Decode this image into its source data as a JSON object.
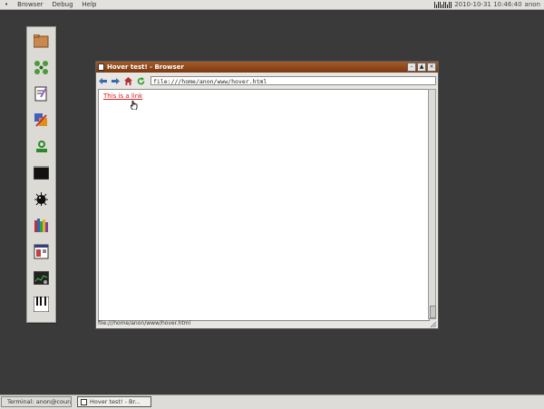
{
  "top_menu": {
    "items": [
      "Browser",
      "Debug",
      "Help"
    ],
    "clock": "2010-10-31 10:46:40",
    "user": "anon"
  },
  "dock": {
    "icons": [
      "folder-icon",
      "grid-icon",
      "notepad-icon",
      "paint-icon",
      "user-manager-icon",
      "terminal-icon",
      "bomb-icon",
      "books-icon",
      "computer-window-icon",
      "system-monitor-icon",
      "piano-icon"
    ]
  },
  "window": {
    "title": "Hover test! - Browser",
    "url": "file:///home/anon/www/hover.html",
    "link_text": "This is a link",
    "status": "file:///home/anon/www/hover.html"
  },
  "taskbar": {
    "tasks": [
      {
        "label": "Terminal: anon@courage:~",
        "active": false
      },
      {
        "label": "Hover test! - Br...",
        "active": true
      }
    ]
  },
  "colors": {
    "desktop": "#3a3a3a",
    "titlebar": "#8c4419",
    "link": "#d02020"
  }
}
